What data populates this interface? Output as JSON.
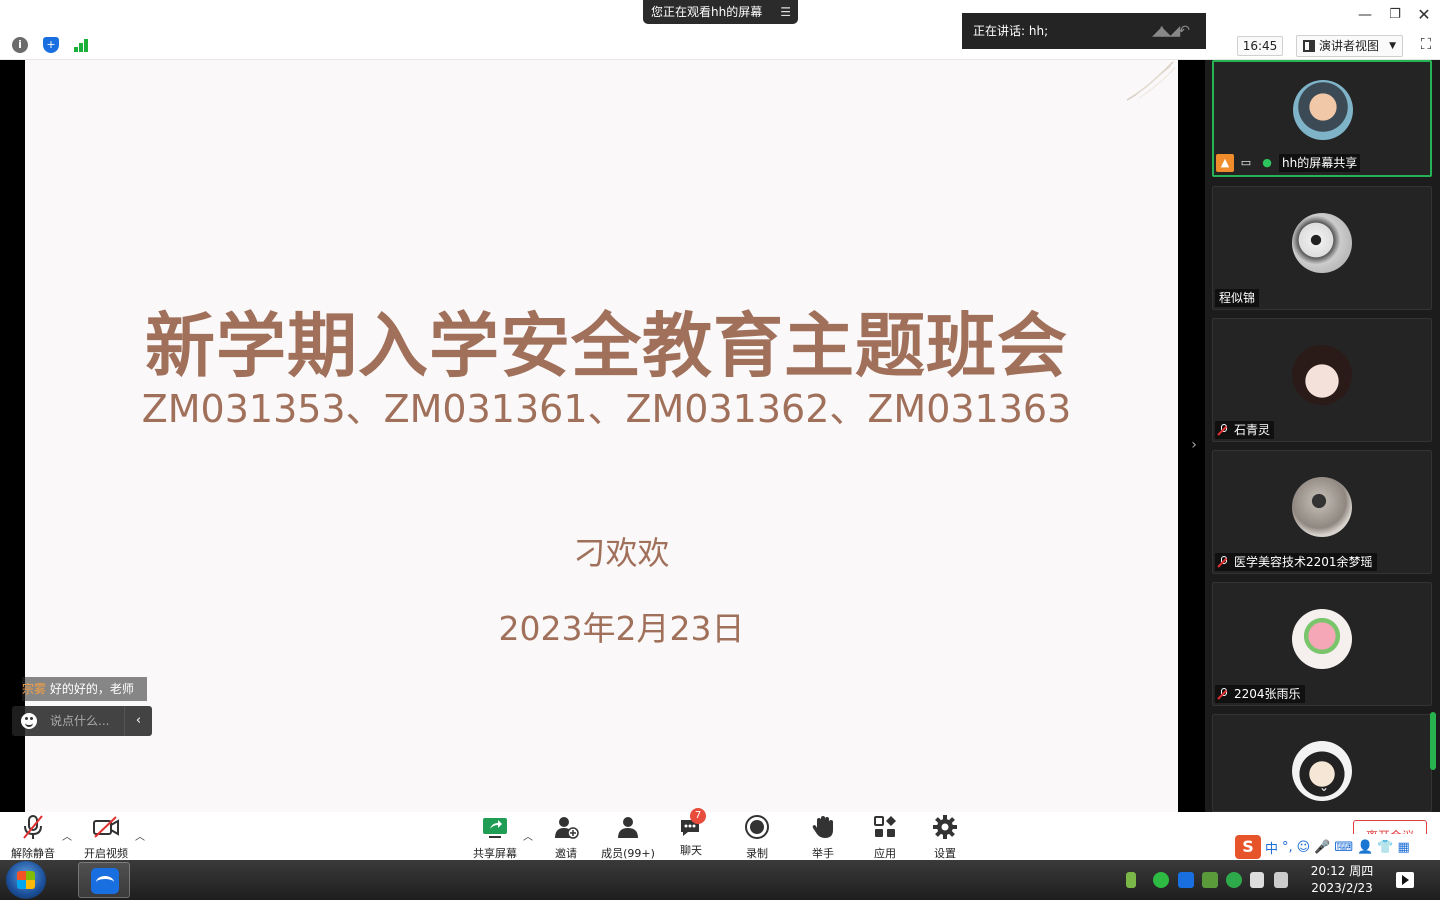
{
  "banner": {
    "viewing": "您正在观看hh的屏幕"
  },
  "talking": {
    "text": "正在讲话: hh;"
  },
  "toolbar": {
    "time": "16:45",
    "view_mode": "演讲者视图"
  },
  "slide": {
    "title": "新学期入学安全教育主题班会",
    "codes": "ZM031353、ZM031361、ZM031362、ZM031363",
    "author": "刁欢欢",
    "date": "2023年2月23日"
  },
  "chat": {
    "last_sender": "宗雾",
    "last_message": "好的好的，老师",
    "input_placeholder": "说点什么..."
  },
  "participants": [
    {
      "name": "hh的屏幕共享"
    },
    {
      "name": "程似锦"
    },
    {
      "name": "石青灵"
    },
    {
      "name": "医学美容技术2201余梦瑶"
    },
    {
      "name": "2204张雨乐"
    },
    {
      "name": ""
    }
  ],
  "bottom": {
    "unmute": "解除静音",
    "start_video": "开启视频",
    "share_screen": "共享屏幕",
    "invite": "邀请",
    "members": "成员(99+)",
    "chat": "聊天",
    "chat_badge": "7",
    "record": "录制",
    "raise_hand": "举手",
    "apps": "应用",
    "settings": "设置",
    "end_meeting": "离开会议"
  },
  "ime": {
    "mode": "中"
  },
  "taskbar": {
    "time": "20:12 周四",
    "date": "2023/2/23"
  },
  "colors": {
    "accent_green": "#26b355",
    "slide_text": "#a0705b",
    "danger": "#e04040"
  }
}
